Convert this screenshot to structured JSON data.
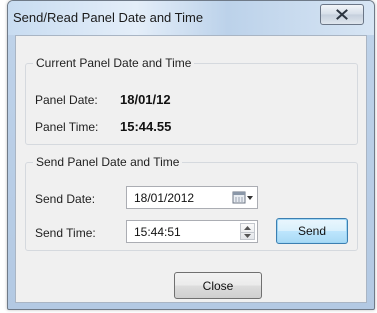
{
  "window": {
    "title": "Send/Read Panel Date and Time"
  },
  "current_group": {
    "title": "Current Panel Date and Time",
    "date_label": "Panel Date:",
    "date_value": "18/01/12",
    "time_label": "Panel Time:",
    "time_value": "15:44.55"
  },
  "send_group": {
    "title": "Send Panel Date and Time",
    "date_label": "Send Date:",
    "date_value": "18/01/2012",
    "time_label": "Send Time:",
    "time_value": "15:44:51",
    "send_button": "Send"
  },
  "footer": {
    "close_button": "Close"
  },
  "icons": {
    "close": "close-x-icon",
    "calendar": "calendar-icon",
    "spin": "spinner-arrows-icon"
  },
  "colors": {
    "title_bar": "#c8dcf1",
    "dialog_bg": "#f0f0f0",
    "default_button_border": "#3c7fb1"
  }
}
